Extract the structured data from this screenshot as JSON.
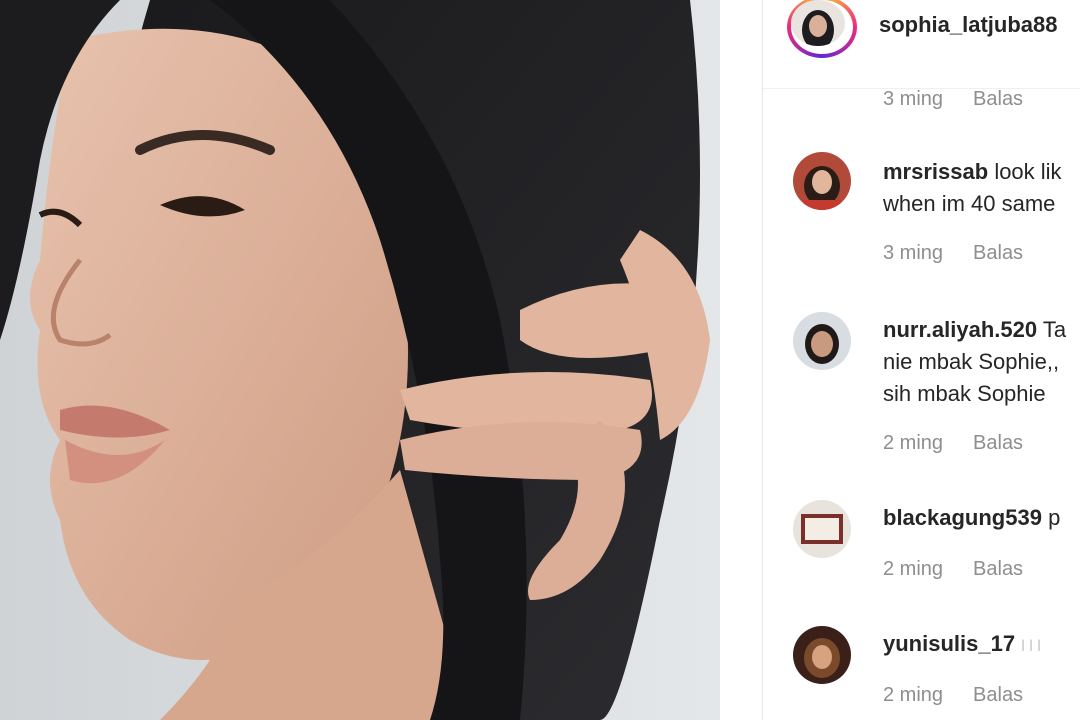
{
  "post": {
    "username": "sophia_latjuba88"
  },
  "partial_reply": {
    "time": "3 ming",
    "reply": "Balas"
  },
  "comments": [
    {
      "username": "mrsrissab",
      "lines": [
        "look lik",
        "when im 40 same"
      ],
      "time": "3 ming",
      "reply": "Balas"
    },
    {
      "username": "nurr.aliyah.520",
      "lines": [
        "Ta",
        "nie mbak Sophie,,",
        "sih mbak Sophie"
      ],
      "time": "2 ming",
      "reply": "Balas"
    },
    {
      "username": "blackagung539",
      "lines": [
        "p"
      ],
      "time": "2 ming",
      "reply": "Balas"
    },
    {
      "username": "yunisulis_17",
      "lines": [
        "l l l"
      ],
      "time": "2 ming",
      "reply": "Balas"
    }
  ]
}
